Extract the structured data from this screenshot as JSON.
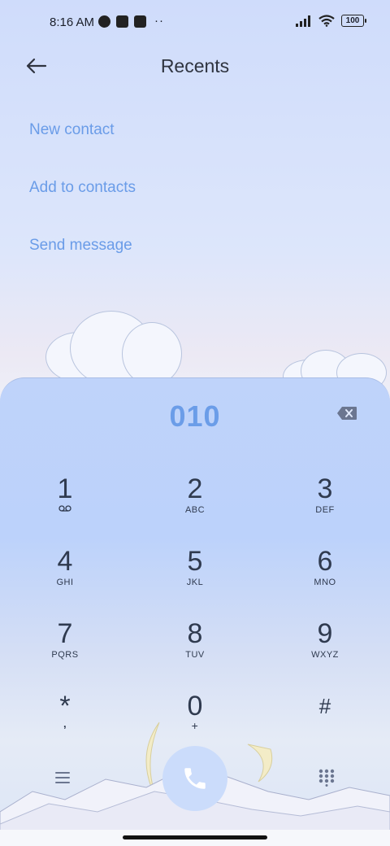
{
  "status_bar": {
    "time": "8:16 AM",
    "dots": "··",
    "battery": "100"
  },
  "header": {
    "title": "Recents"
  },
  "actions": [
    {
      "label": "New contact"
    },
    {
      "label": "Add to contacts"
    },
    {
      "label": "Send message"
    }
  ],
  "dialer": {
    "number": "010",
    "keys": [
      {
        "digit": "1",
        "letters": ""
      },
      {
        "digit": "2",
        "letters": "ABC"
      },
      {
        "digit": "3",
        "letters": "DEF"
      },
      {
        "digit": "4",
        "letters": "GHI"
      },
      {
        "digit": "5",
        "letters": "JKL"
      },
      {
        "digit": "6",
        "letters": "MNO"
      },
      {
        "digit": "7",
        "letters": "PQRS"
      },
      {
        "digit": "8",
        "letters": "TUV"
      },
      {
        "digit": "9",
        "letters": "WXYZ"
      },
      {
        "digit": "*",
        "letters": ","
      },
      {
        "digit": "0",
        "letters": "+"
      },
      {
        "digit": "#",
        "letters": ""
      }
    ]
  },
  "icons": {
    "back": "arrow-left-icon",
    "delete": "backspace-icon",
    "voicemail": "voicemail-icon",
    "menu": "menu-icon",
    "call": "phone-icon",
    "dialpad": "dialpad-icon"
  },
  "colors": {
    "accent": "#6a9ce8",
    "key_text": "#2f3a4f",
    "call_button": "#cbdcfb"
  }
}
